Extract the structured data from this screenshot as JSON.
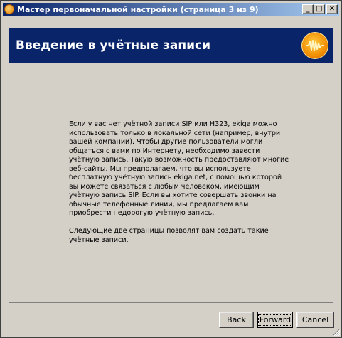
{
  "window": {
    "title": "Мастер первоначальной настройки (страница 3 из 9)",
    "minimize_label": "_",
    "maximize_label": "□",
    "close_label": "✕"
  },
  "header": {
    "title": "Введение в учётные записи"
  },
  "content": {
    "paragraph1": "Если у вас нет учётной записи SIP или H323, ekiga можно использовать только в локальной сети (например, внутри вашей компании). Чтобы другие пользователи могли общаться с вами по Интернету, необходимо завести учётную запись. Такую возможность предоставляют многие веб-сайты. Мы предполагаем, что вы используете бесплатную учётную запись ekiga.net, с помощью которой вы можете связаться с любым человеком, имеющим учётную запись SIP. Если вы хотите совершать звонки на обычные телефонные линии, мы предлагаем вам приобрести недорогую учётную запись.",
    "paragraph2": "Следующие две страницы позволят вам создать такие учётные записи."
  },
  "buttons": {
    "back": "Back",
    "forward": "Forward",
    "cancel": "Cancel"
  },
  "colors": {
    "titlebar_start": "#0a246a",
    "titlebar_end": "#a6caf0",
    "header_bg": "#0a246a",
    "window_bg": "#d4d0c8"
  }
}
